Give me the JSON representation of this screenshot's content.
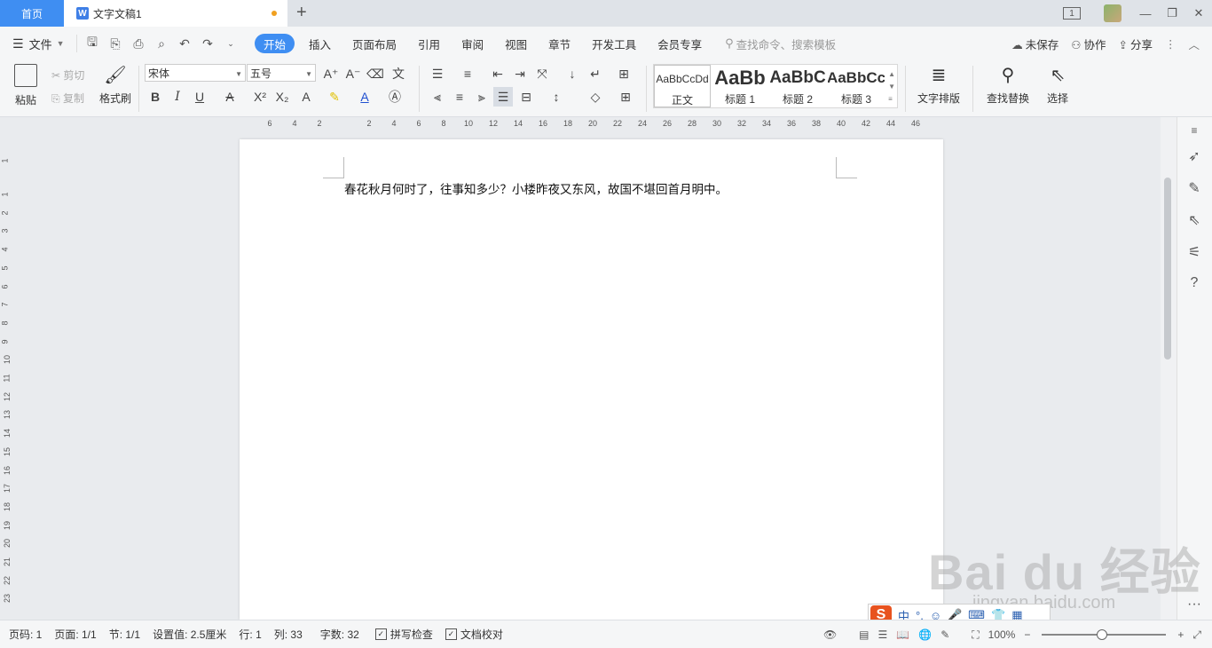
{
  "tabs": {
    "home": "首页",
    "doc_title": "文字文稿1",
    "add": "+"
  },
  "window": {
    "page_indicator": "1",
    "minimize": "—",
    "restore": "❐",
    "close": "✕"
  },
  "menu": {
    "file": "文件",
    "tabs": [
      "开始",
      "插入",
      "页面布局",
      "引用",
      "审阅",
      "视图",
      "章节",
      "开发工具",
      "会员专享"
    ],
    "search_placeholder": "查找命令、搜索模板",
    "unsaved": "未保存",
    "collaborate": "协作",
    "share": "分享"
  },
  "ribbon": {
    "paste": "粘贴",
    "cut": "剪切",
    "copy": "复制",
    "format_painter": "格式刷",
    "font_name": "宋体",
    "font_size": "五号",
    "styles": [
      {
        "sample": "AaBbCcDd",
        "label": "正文"
      },
      {
        "sample": "AaBb",
        "label": "标题 1"
      },
      {
        "sample": "AaBbC",
        "label": "标题 2"
      },
      {
        "sample": "AaBbCc",
        "label": "标题 3"
      }
    ],
    "text_layout": "文字排版",
    "find_replace": "查找替换",
    "select": "选择"
  },
  "ruler": {
    "h_left": [
      "6",
      "4",
      "2"
    ],
    "h_right": [
      "2",
      "4",
      "6",
      "8",
      "10",
      "12",
      "14",
      "16",
      "18",
      "20",
      "22",
      "24",
      "26",
      "28",
      "30",
      "32",
      "34",
      "36",
      "38",
      "40",
      "42",
      "44",
      "46"
    ],
    "v": [
      "1",
      "1",
      "2",
      "3",
      "4",
      "5",
      "6",
      "7",
      "8",
      "9",
      "10",
      "11",
      "12",
      "13",
      "14",
      "15",
      "16",
      "17",
      "18",
      "19",
      "20",
      "21",
      "22",
      "23"
    ]
  },
  "document": {
    "text": "春花秋月何时了，往事知多少？小楼昨夜又东风，故国不堪回首月明中。"
  },
  "status": {
    "page_num": "页码: 1",
    "pages": "页面: 1/1",
    "section": "节: 1/1",
    "setting": "设置值: 2.5厘米",
    "row": "行: 1",
    "col": "列: 33",
    "words": "字数: 32",
    "spell_check": "拼写检查",
    "doc_proof": "文档校对",
    "zoom": "100%"
  },
  "ime": {
    "chinese": "中",
    "punct": "°,"
  },
  "watermark": {
    "main": "Bai du 经验",
    "sub": "jingyan.baidu.com"
  }
}
